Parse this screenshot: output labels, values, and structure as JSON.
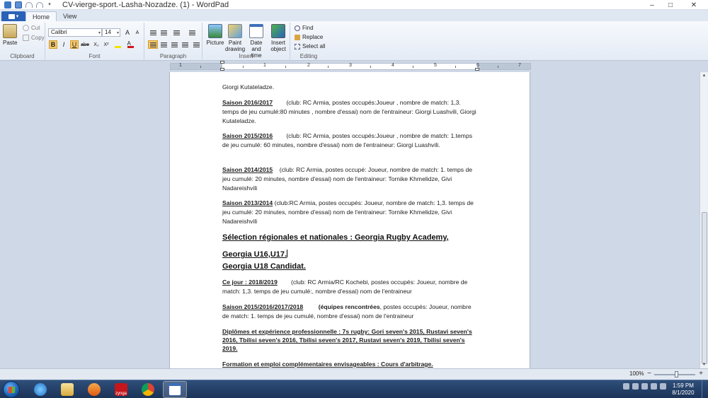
{
  "window": {
    "title": "CV-vierge-sport.-Lasha-Nozadze. (1) - WordPad",
    "controls": [
      "–",
      "□",
      "✕"
    ]
  },
  "ribbon": {
    "tabs": [
      "Home",
      "View"
    ],
    "clipboard": {
      "label": "Clipboard",
      "paste": "Paste",
      "cut": "Cut",
      "copy": "Copy"
    },
    "font": {
      "label": "Font",
      "family": "Calibri",
      "size": "14",
      "grow": "A",
      "shrink": "A",
      "bold": "B",
      "italic": "I",
      "underline": "U",
      "strike": "abe",
      "sub": "X₂",
      "sup": "X²"
    },
    "paragraph": {
      "label": "Paragraph"
    },
    "insert": {
      "label": "Insert",
      "picture": "Picture",
      "paint": "Paint drawing",
      "datetime": "Date and time",
      "object": "Insert object"
    },
    "editing": {
      "label": "Editing",
      "find": "Find",
      "replace": "Replace",
      "select_all": "Select all"
    }
  },
  "ruler": {
    "numbers": [
      "1",
      "1",
      "2",
      "3",
      "4",
      "5",
      "6",
      "7"
    ]
  },
  "document": {
    "p0": "Giorgi Kutateladze.",
    "p1_head": "Saison 2016/2017",
    "p1_body": "(club: RC Armia, postes occupés:Joueur , nombre de match: 1,3. temps de jeu cumulé:80 minutes , nombre d'essai) nom de l'entraineur: Giorgi Luashvili, Giorgi Kutateladze.",
    "p2_head": "Saison 2015/2016",
    "p2_body": "(club: RC Armia, postes occupés:Joueur , nombre de match: 1.temps de jeu cumulé: 60 minutes, nombre d'essai) nom de l'entraineur: Giorgi Luashvili.",
    "p3_head": "Saison 2014/2015",
    "p3_body": "(club: RC Armia, postes occupé: Joueur, nombre de match: 1. temps de jeu cumulé: 20 minutes, nombre d'essai) nom de l'entraineur: Tornike Khmelidze, Givi Nadareishvili",
    "p4_head": "Saison 2013/2014",
    "p4_body": "(club:RC Armia, postes occupés: Joueur, nombre de match: 1,3. temps de jeu cumulé: 20 minutes, nombre d'essai) nom de l'entraineur: Tornike Khmelidze, Givi Nadareishvili",
    "h1": "Sélection régionales et nationales : Georgia Rugby Academy,",
    "h2": "Georgia U16,U17.",
    "h3": "Georgia U18 Candidat.",
    "p5_head": "Ce jour : 2018/2019",
    "p5_body": "(club: RC Armia/RC Kochebi, postes occupés: Joueur, nombre de match: 1,3. temps de jeu cumulé:, nombre d'essai) nom de l'entraineur",
    "p6_head": "Saison 2015/2016/2017/2018",
    "p6_bold": "(équipes rencontrées",
    "p6_body": ", postes occupés: Joueur, nombre de match: 1. temps de jeu cumulé, nombre d'essai) nom de l'entraineur",
    "p7": "Diplômes et expérience professionnelle : 7s rugby: Gori seven's 2015, Rustavi seven's 2016, Tbilisi seven's 2016, Tbilisi seven's 2017, Rustavi seven's 2019, Tbilisi seven's 2019.",
    "p8": "Formation et emploi complémentaires envisageables : Cours d'arbitrage."
  },
  "status": {
    "zoom": "100%",
    "zoom_out": "−",
    "zoom_in": "+",
    "zoom_level": 1.0
  },
  "taskbar": {
    "zynga": "zynga",
    "time": "1:59 PM",
    "date": "8/1/2020"
  },
  "colors": {
    "accent": "#2a62b8",
    "taskbar": "#1b3358",
    "highlight": "#f7c96a"
  }
}
